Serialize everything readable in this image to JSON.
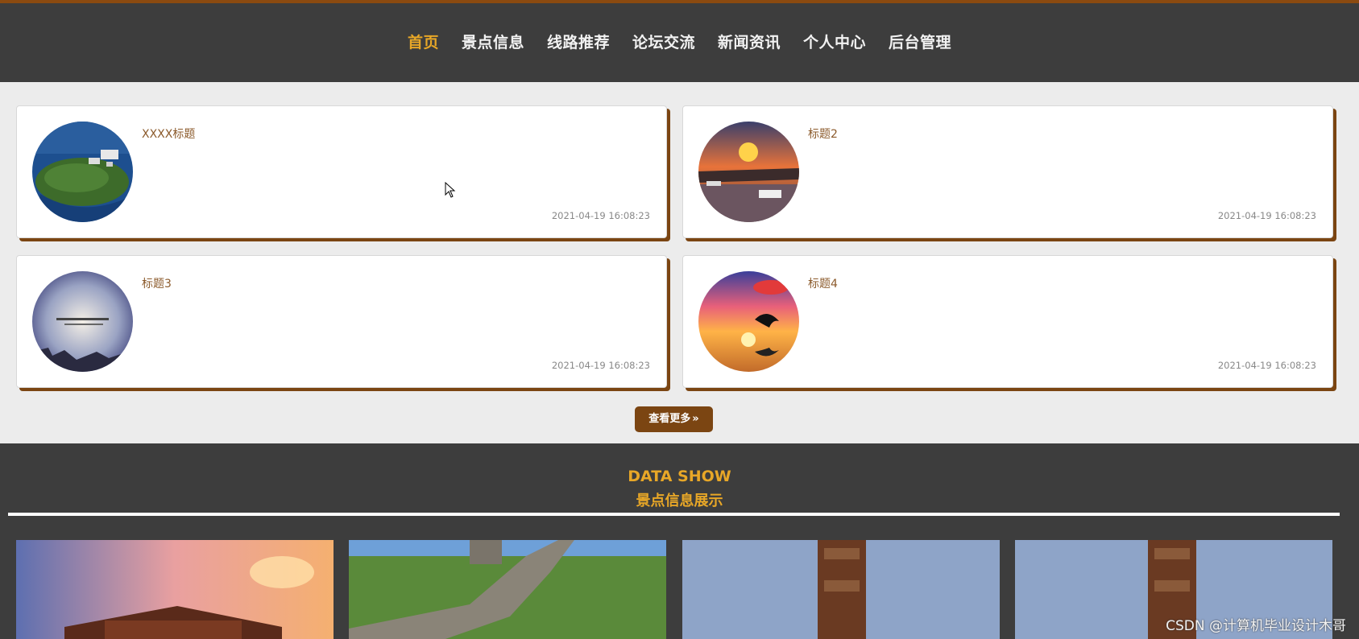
{
  "nav": {
    "items": [
      "首页",
      "景点信息",
      "线路推荐",
      "论坛交流",
      "新闻资讯",
      "个人中心",
      "后台管理"
    ],
    "active_index": 0
  },
  "news": [
    {
      "title": "XXXX标题",
      "time": "2021-04-19 16:08:23",
      "image": "island-aerial"
    },
    {
      "title": "标题2",
      "time": "2021-04-19 16:08:23",
      "image": "river-sunset-boats"
    },
    {
      "title": "标题3",
      "time": "2021-04-19 16:08:23",
      "image": "misty-sky-calligraphy"
    },
    {
      "title": "标题4",
      "time": "2021-04-19 16:08:23",
      "image": "dolphin-sunset"
    }
  ],
  "more_button": {
    "label": "查看更多",
    "icon": "double-chevron-right-icon"
  },
  "data_show": {
    "title": "DATA SHOW",
    "subtitle": "景点信息展示",
    "tiles": [
      "palace-sunset",
      "great-wall",
      "totem-statue",
      "totem-statue"
    ]
  },
  "watermark": "CSDN @计算机毕业设计木哥",
  "colors": {
    "accent": "#e8a727",
    "brown": "#7b4512",
    "dark": "#3d3d3d"
  }
}
